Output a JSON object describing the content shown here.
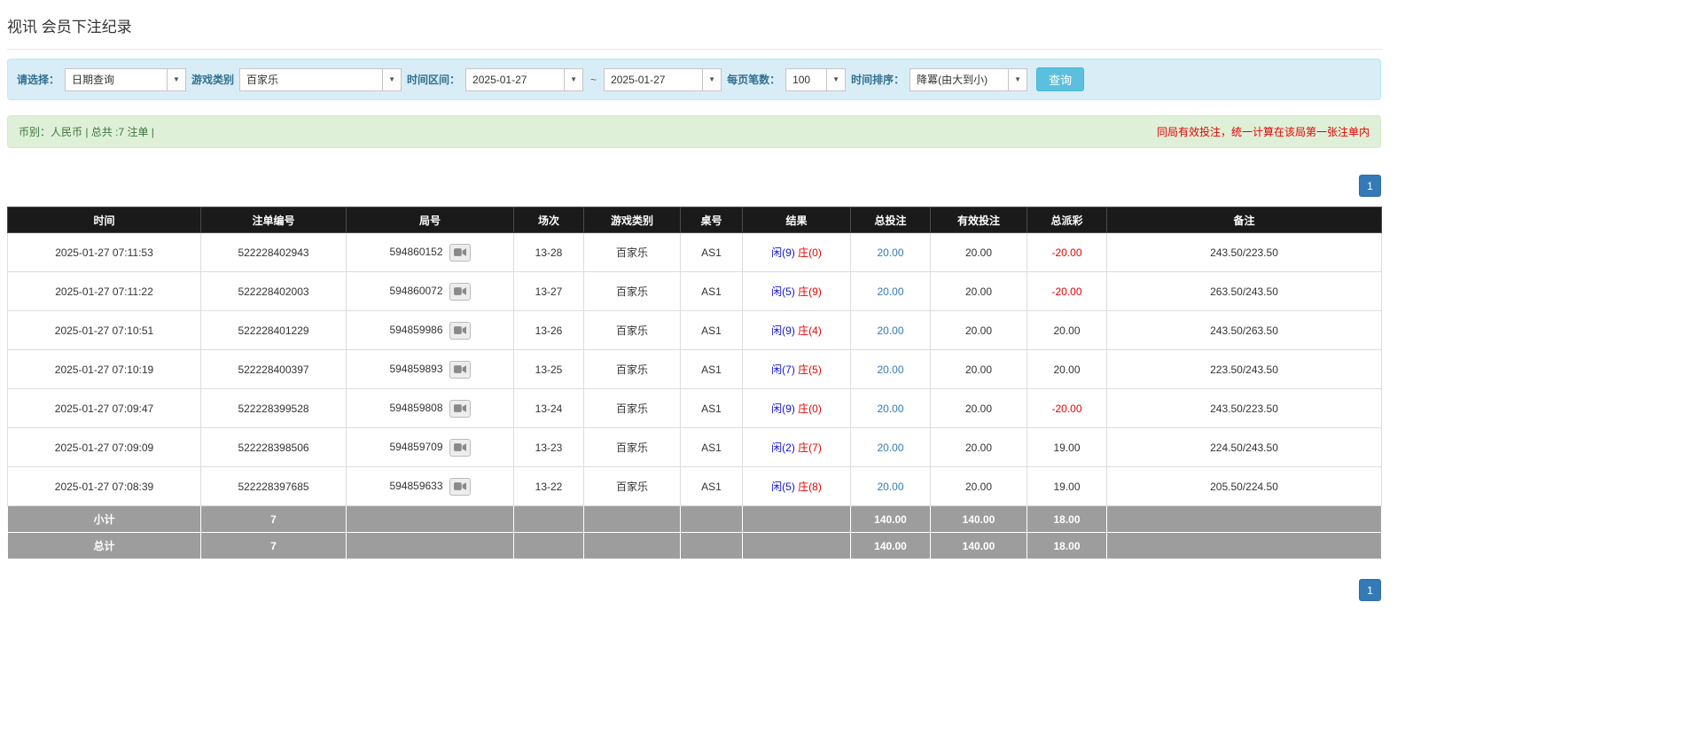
{
  "page": {
    "title": "视讯 会员下注纪录"
  },
  "filter": {
    "select_label": "请选择：",
    "select_value": "日期查询",
    "game_label": "游戏类别",
    "game_value": "百家乐",
    "range_label": "时间区间：",
    "date_from": "2025-01-27",
    "tilde": "~",
    "date_to": "2025-01-27",
    "page_size_label": "每页笔数：",
    "page_size_value": "100",
    "sort_label": "时间排序：",
    "sort_value": "降冪(由大到小)",
    "search_label": "查询",
    "arrow_icon": "▼"
  },
  "summary": {
    "currency_info": "币别：人民币 | 总共 :7 注单 |",
    "notice": "同局有效投注，统一计算在该局第一张注单内"
  },
  "pagination": {
    "current": "1"
  },
  "table": {
    "headers": [
      "时间",
      "注单编号",
      "局号",
      "场次",
      "游戏类别",
      "桌号",
      "结果",
      "总投注",
      "有效投注",
      "总派彩",
      "备注"
    ],
    "rows": [
      {
        "time": "2025-01-27 07:11:53",
        "bet_id": "522228402943",
        "round_id": "594860152",
        "session": "13-28",
        "game": "百家乐",
        "table_no": "AS1",
        "result_player": "闲(9)",
        "result_banker": "庄(0)",
        "total_bet": "20.00",
        "valid_bet": "20.00",
        "payout": "-20.00",
        "note": "243.50/223.50"
      },
      {
        "time": "2025-01-27 07:11:22",
        "bet_id": "522228402003",
        "round_id": "594860072",
        "session": "13-27",
        "game": "百家乐",
        "table_no": "AS1",
        "result_player": "闲(5)",
        "result_banker": "庄(9)",
        "total_bet": "20.00",
        "valid_bet": "20.00",
        "payout": "-20.00",
        "note": "263.50/243.50"
      },
      {
        "time": "2025-01-27 07:10:51",
        "bet_id": "522228401229",
        "round_id": "594859986",
        "session": "13-26",
        "game": "百家乐",
        "table_no": "AS1",
        "result_player": "闲(9)",
        "result_banker": "庄(4)",
        "total_bet": "20.00",
        "valid_bet": "20.00",
        "payout": "20.00",
        "note": "243.50/263.50"
      },
      {
        "time": "2025-01-27 07:10:19",
        "bet_id": "522228400397",
        "round_id": "594859893",
        "session": "13-25",
        "game": "百家乐",
        "table_no": "AS1",
        "result_player": "闲(7)",
        "result_banker": "庄(5)",
        "total_bet": "20.00",
        "valid_bet": "20.00",
        "payout": "20.00",
        "note": "223.50/243.50"
      },
      {
        "time": "2025-01-27 07:09:47",
        "bet_id": "522228399528",
        "round_id": "594859808",
        "session": "13-24",
        "game": "百家乐",
        "table_no": "AS1",
        "result_player": "闲(9)",
        "result_banker": "庄(0)",
        "total_bet": "20.00",
        "valid_bet": "20.00",
        "payout": "-20.00",
        "note": "243.50/223.50"
      },
      {
        "time": "2025-01-27 07:09:09",
        "bet_id": "522228398506",
        "round_id": "594859709",
        "session": "13-23",
        "game": "百家乐",
        "table_no": "AS1",
        "result_player": "闲(2)",
        "result_banker": "庄(7)",
        "total_bet": "20.00",
        "valid_bet": "20.00",
        "payout": "19.00",
        "note": "224.50/243.50"
      },
      {
        "time": "2025-01-27 07:08:39",
        "bet_id": "522228397685",
        "round_id": "594859633",
        "session": "13-22",
        "game": "百家乐",
        "table_no": "AS1",
        "result_player": "闲(5)",
        "result_banker": "庄(8)",
        "total_bet": "20.00",
        "valid_bet": "20.00",
        "payout": "19.00",
        "note": "205.50/224.50"
      }
    ],
    "subtotal": {
      "label": "小计",
      "count": "7",
      "total_bet": "140.00",
      "valid_bet": "140.00",
      "payout": "18.00"
    },
    "total": {
      "label": "总计",
      "count": "7",
      "total_bet": "140.00",
      "valid_bet": "140.00",
      "payout": "18.00"
    }
  }
}
